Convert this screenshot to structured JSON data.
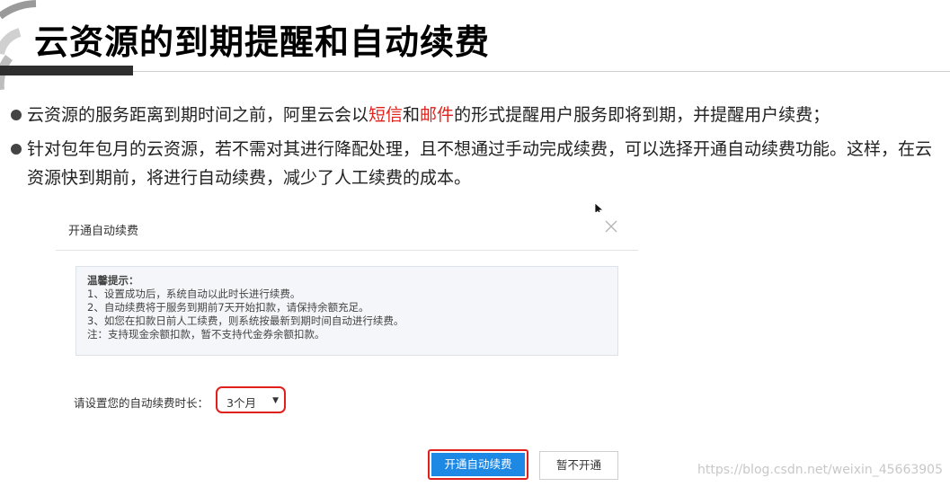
{
  "slide": {
    "title": "云资源的到期提醒和自动续费",
    "bullets": [
      {
        "pre": "云资源的服务距离到期时间之前，阿里云会以",
        "red1": "短信",
        "mid": "和",
        "red2": "邮件",
        "post": "的形式提醒用户服务即将到期，并提醒用户续费；"
      },
      {
        "text": "针对包年包月的云资源，若不需对其进行降配处理，且不想通过手动完成续费，可以选择开通自动续费功能。这样，在云资源快到期前，将进行自动续费，减少了人工续费的成本。"
      }
    ]
  },
  "dialog": {
    "title": "开通自动续费",
    "tip_title": "温馨提示：",
    "tips": [
      "1、设置成功后，系统自动以此时长进行续费。",
      "2、自动续费将于服务到期前7天开始扣款，请保持余额充足。",
      "3、如您在扣款日前人工续费，则系统按最新到期时间自动进行续费。",
      "注：支持现金余额扣款，暂不支持代金券余额扣款。"
    ],
    "duration_label": "请设置您的自动续费时长：",
    "duration_value": "3个月",
    "enable_button": "开通自动续费",
    "later_button": "暂不开通"
  },
  "watermark": "https://blog.csdn.net/weixin_45663905",
  "colors": {
    "accent_red": "#e0211b",
    "button_blue": "#1e88e5"
  }
}
